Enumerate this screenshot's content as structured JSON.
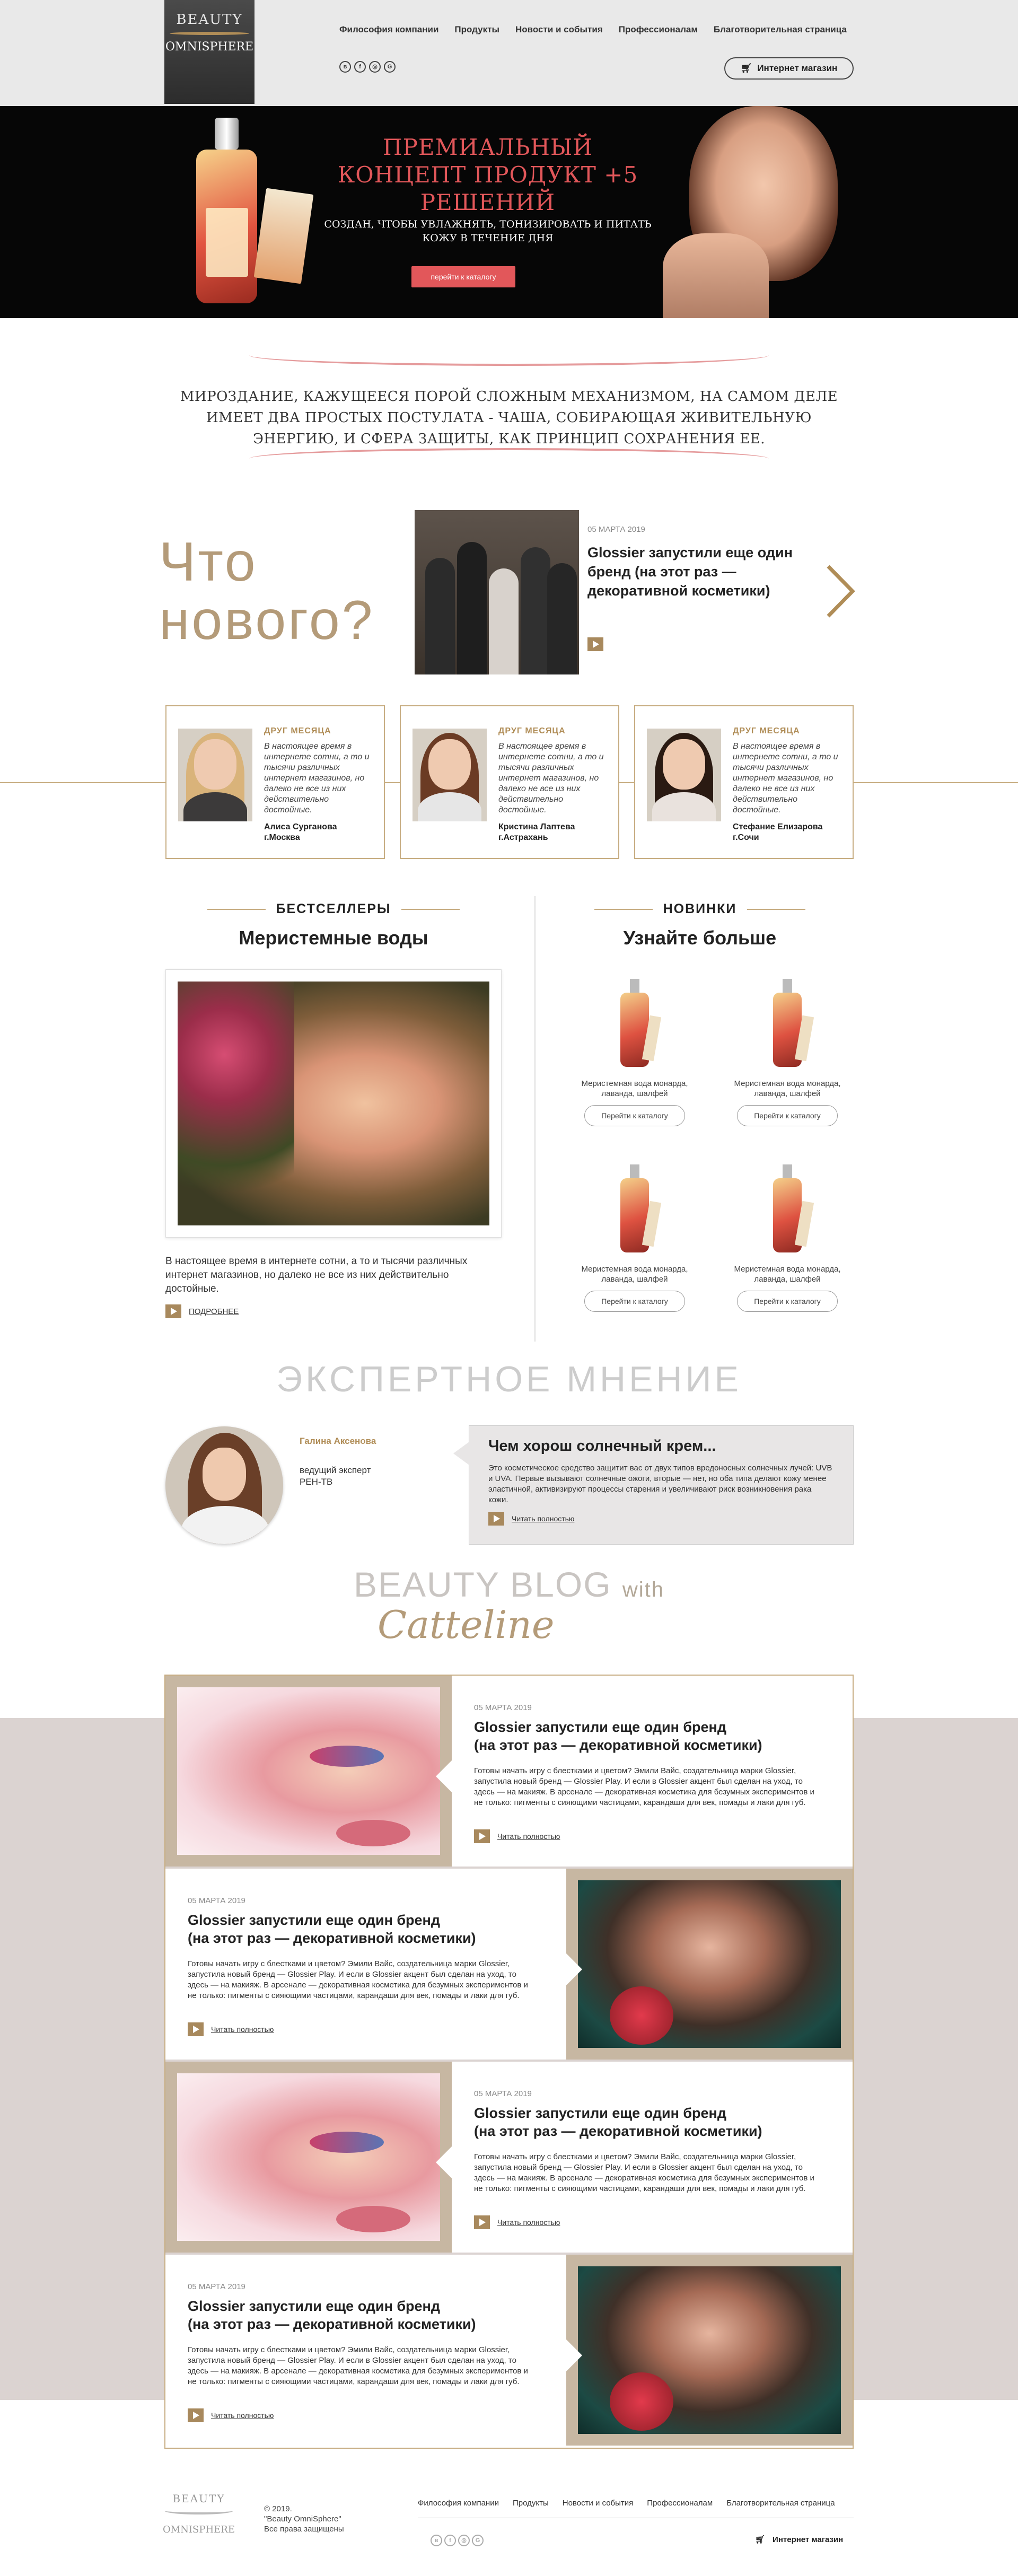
{
  "header": {
    "logo_top": "BEAUTY",
    "logo_bottom": "OMNISPHERE",
    "nav": [
      "Философия компании",
      "Продукты",
      "Новости и события",
      "Профессионалам",
      "Благотворительная страница"
    ],
    "socials": [
      "vk-icon",
      "facebook-icon",
      "instagram-icon",
      "googleplus-icon"
    ],
    "shop_label": "Интернет магазин"
  },
  "hero": {
    "title": "ПРЕМИАЛЬНЫЙ КОНЦЕПТ ПРОДУКТ +5 РЕШЕНИЙ",
    "subtitle": "СОЗДАН, ЧТОБЫ УВЛАЖНЯТЬ, ТОНИЗИРОВАТЬ И ПИТАТЬ КОЖУ В ТЕЧЕНИЕ ДНЯ",
    "cta": "перейти к каталогу"
  },
  "quote": "МИРОЗДАНИЕ, КАЖУЩЕЕСЯ ПОРОЙ СЛОЖНЫМ МЕХАНИЗМОМ, НА САМОМ ДЕЛЕ ИМЕЕТ ДВА ПРОСТЫХ ПОСТУЛАТА - ЧАША, СОБИРАЮЩАЯ ЖИВИТЕЛЬНУЮ ЭНЕРГИЮ, И СФЕРА ЗАЩИТЫ, КАК ПРИНЦИП СОХРАНЕНИЯ ЕЕ.",
  "whatsnew": {
    "heading_1": "Что",
    "heading_2": "нового?",
    "date": "05 МАРТА 2019",
    "title": "Glossier запустили еще один бренд (на этот раз — декоративной косметики)"
  },
  "friends": [
    {
      "title": "ДРУГ МЕСЯЦА",
      "text": "В настоящее время в интернете сотни, а то и тысячи различных интернет магазинов, но далеко не все из них действительно достойные.",
      "name": "Алиса Сурганова",
      "city": "г.Москва"
    },
    {
      "title": "ДРУГ МЕСЯЦА",
      "text": "В настоящее время в интернете сотни, а то и тысячи различных интернет магазинов, но далеко не все из них действительно достойные.",
      "name": "Кристина Лаптева",
      "city": "г.Астрахань"
    },
    {
      "title": "ДРУГ МЕСЯЦА",
      "text": "В настоящее время в интернете сотни, а то и тысячи различных интернет магазинов, но далеко не все из них действительно достойные.",
      "name": "Стефание Елизарова",
      "city": "г.Сочи"
    }
  ],
  "bestsellers": {
    "label": "БЕСТСЕЛЛЕРЫ",
    "title": "Меристемные воды",
    "text": "В настоящее время в интернете сотни, а то и тысячи различных интернет магазинов, но далеко не все из них действительно достойные.",
    "more": "ПОДРОБНЕЕ"
  },
  "novelties": {
    "label": "НОВИНКИ",
    "title": "Узнайте больше",
    "products": [
      {
        "name": "Меристемная вода монарда, лаванда, шалфей",
        "button": "Перейти к каталогу"
      },
      {
        "name": "Меристемная вода монарда, лаванда, шалфей",
        "button": "Перейти к каталогу"
      },
      {
        "name": "Меристемная вода монарда, лаванда, шалфей",
        "button": "Перейти к каталогу"
      },
      {
        "name": "Меристемная вода монарда, лаванда, шалфей",
        "button": "Перейти к каталогу"
      }
    ]
  },
  "expert": {
    "heading": "ЭКСПЕРТНОЕ МНЕНИЕ",
    "name": "Галина Аксенова",
    "role": "ведущий эксперт РЕН-ТВ",
    "title": "Чем хорош солнечный крем...",
    "text": "Это косметическое средство защитит вас от двух типов вредоносных солнечных лучей: UVB и UVA. Первые вызывают солнечные ожоги, вторые — нет, но оба типа делают кожу менее эластичной, активизируют процессы старения и увеличивают риск возникновения рака кожи.",
    "read": "Читать полностью"
  },
  "blog": {
    "heading": "BEAUTY BLOG",
    "with": "with",
    "signature": "Catteline",
    "posts": [
      {
        "date": "05 МАРТА 2019",
        "title_1": "Glossier запустили еще один бренд",
        "title_2": "(на этот раз — декоративной косметики)",
        "text": "Готовы начать игру с блестками и цветом? Эмили Вайс, создательница марки Glossier, запустила новый бренд — Glossier Play. И если в Glossier акцент был сделан на уход, то здесь — на макияж. В арсенале — декоративная косметика для безумных экспериментов и не только: пигменты с сияющими частицами, карандаши для век, помады и лаки для губ.",
        "read": "Читать полностью"
      },
      {
        "date": "05 МАРТА 2019",
        "title_1": "Glossier запустили еще один бренд",
        "title_2": "(на этот раз — декоративной косметики)",
        "text": "Готовы начать игру с блестками и цветом? Эмили Вайс, создательница марки Glossier, запустила новый бренд — Glossier Play. И если в Glossier акцент был сделан на уход, то здесь — на макияж. В арсенале — декоративная косметика для безумных экспериментов и не только: пигменты с сияющими частицами, карандаши для век, помады и лаки для губ.",
        "read": "Читать полностью"
      },
      {
        "date": "05 МАРТА 2019",
        "title_1": "Glossier запустили еще один бренд",
        "title_2": "(на этот раз — декоративной косметики)",
        "text": "Готовы начать игру с блестками и цветом? Эмили Вайс, создательница марки Glossier, запустила новый бренд — Glossier Play. И если в Glossier акцент был сделан на уход, то здесь — на макияж. В арсенале — декоративная косметика для безумных экспериментов и не только: пигменты с сияющими частицами, карандаши для век, помады и лаки для губ.",
        "read": "Читать полностью"
      },
      {
        "date": "05 МАРТА 2019",
        "title_1": "Glossier запустили еще один бренд",
        "title_2": "(на этот раз — декоративной косметики)",
        "text": "Готовы начать игру с блестками и цветом? Эмили Вайс, создательница марки Glossier, запустила новый бренд — Glossier Play. И если в Glossier акцент был сделан на уход, то здесь — на макияж. В арсенале — декоративная косметика для безумных экспериментов и не только: пигменты с сияющими частицами, карандаши для век, помады и лаки для губ.",
        "read": "Читать полностью"
      }
    ]
  },
  "footer": {
    "logo_top": "BEAUTY",
    "logo_bottom": "OMNISPHERE",
    "copy_1": "© 2019.",
    "copy_2": "\"Beauty OmniSphere\"",
    "copy_3": "Все права защищены",
    "nav": [
      "Философия компании",
      "Продукты",
      "Новости и события",
      "Профессионалам",
      "Благотворительная страница"
    ],
    "shop_label": "Интернет магазин"
  },
  "colors": {
    "accent": "#e2575a",
    "gold": "#b08d57",
    "beige": "#c7ad82"
  }
}
